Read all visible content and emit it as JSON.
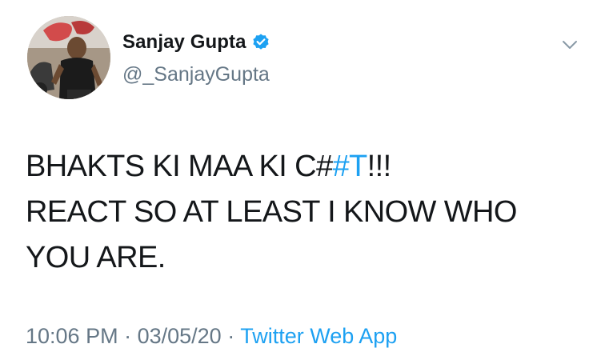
{
  "tweet": {
    "display_name": "Sanjay Gupta",
    "verified": true,
    "handle": "@_SanjayGupta",
    "text": {
      "line1_before": "BHAKTS KI MAA KI C#",
      "line1_hashtag": "#T",
      "line1_after": "!!!",
      "line2": "REACT SO AT LEAST I KNOW WHO",
      "line3": "YOU ARE."
    },
    "time": "10:06 PM",
    "separator": " · ",
    "date": "03/05/20",
    "source": "Twitter Web App"
  },
  "icons": {
    "verified_badge": "verified-badge-icon",
    "menu_caret": "chevron-down-icon",
    "avatar": "profile-photo"
  },
  "colors": {
    "link_blue": "#1da1f2",
    "secondary_gray": "#657786",
    "text_dark": "#14171a"
  }
}
